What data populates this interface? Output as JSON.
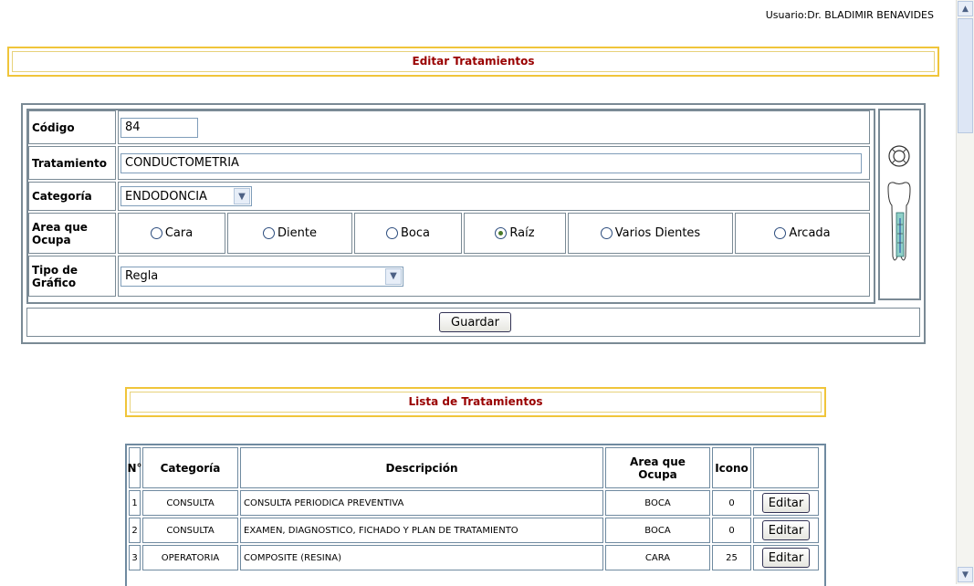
{
  "header": {
    "user": "Usuario:Dr. BLADIMIR BENAVIDES"
  },
  "edit": {
    "title": "Editar Tratamientos",
    "codigo_label": "Código",
    "codigo_value": "84",
    "tratamiento_label": "Tratamiento",
    "tratamiento_value": "CONDUCTOMETRIA",
    "categoria_label": "Categoría",
    "categoria_value": "ENDODONCIA",
    "area_label": "Area que Ocupa",
    "area_options": [
      "Cara",
      "Diente",
      "Boca",
      "Raíz",
      "Varios Dientes",
      "Arcada"
    ],
    "area_selected": "Raíz",
    "grafico_label": "Tipo de Gráfico",
    "grafico_value": "Regla",
    "save_label": "Guardar"
  },
  "list": {
    "title": "Lista de Tratamientos",
    "headers": [
      "N°",
      "Categoría",
      "Descripción",
      "Area que Ocupa",
      "Icono",
      ""
    ],
    "rows": [
      {
        "n": "1",
        "categoria": "CONSULTA",
        "descripcion": "CONSULTA PERIODICA PREVENTIVA",
        "area": "BOCA",
        "icono": "0",
        "action": "Editar"
      },
      {
        "n": "2",
        "categoria": "CONSULTA",
        "descripcion": "EXAMEN, DIAGNOSTICO, FICHADO Y PLAN DE TRATAMIENTO",
        "area": "BOCA",
        "icono": "0",
        "action": "Editar"
      },
      {
        "n": "3",
        "categoria": "OPERATORIA",
        "descripcion": "COMPOSITE (RESINA)",
        "area": "CARA",
        "icono": "25",
        "action": "Editar"
      }
    ]
  }
}
